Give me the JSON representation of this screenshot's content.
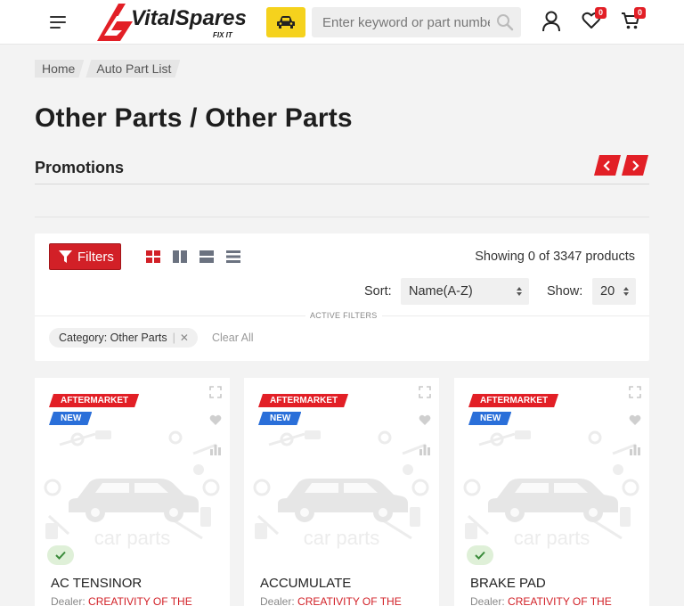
{
  "header": {
    "logo_text": "VitalSpares",
    "logo_tagline": "FIX IT",
    "search_placeholder": "Enter keyword or part number",
    "wishlist_count": "0",
    "cart_count": "0",
    "accent_color": "#e21f26",
    "car_button_color": "#f5d21d"
  },
  "breadcrumb": [
    "Home",
    "Auto Part List"
  ],
  "page_title": "Other Parts / Other Parts",
  "promotions": {
    "title": "Promotions"
  },
  "toolbar": {
    "filters_label": "Filters",
    "view_modes": [
      "grid-icon",
      "columns-icon",
      "list-wide-icon",
      "list-icon"
    ],
    "showing_text": "Showing 0 of 3347 products",
    "sort_label": "Sort:",
    "sort_value": "Name(A-Z)",
    "show_label": "Show:",
    "show_value": "20",
    "active_filters_label": "ACTIVE FILTERS",
    "filter_chip": "Category: Other Parts",
    "clear_all": "Clear All"
  },
  "products": [
    {
      "name": "AC TENSINOR",
      "tag1": "AFTERMARKET",
      "tag2": "NEW",
      "dealer_label": "Dealer:",
      "dealer": "CREATIVITY OF THE",
      "in_stock": true,
      "placeholder_text": "car parts"
    },
    {
      "name": "ACCUMULATE",
      "tag1": "AFTERMARKET",
      "tag2": "NEW",
      "dealer_label": "Dealer:",
      "dealer": "CREATIVITY OF THE",
      "in_stock": false,
      "placeholder_text": "car parts"
    },
    {
      "name": "BRAKE PAD",
      "tag1": "AFTERMARKET",
      "tag2": "NEW",
      "dealer_label": "Dealer:",
      "dealer": "CREATIVITY OF THE",
      "in_stock": true,
      "placeholder_text": "car parts"
    }
  ]
}
